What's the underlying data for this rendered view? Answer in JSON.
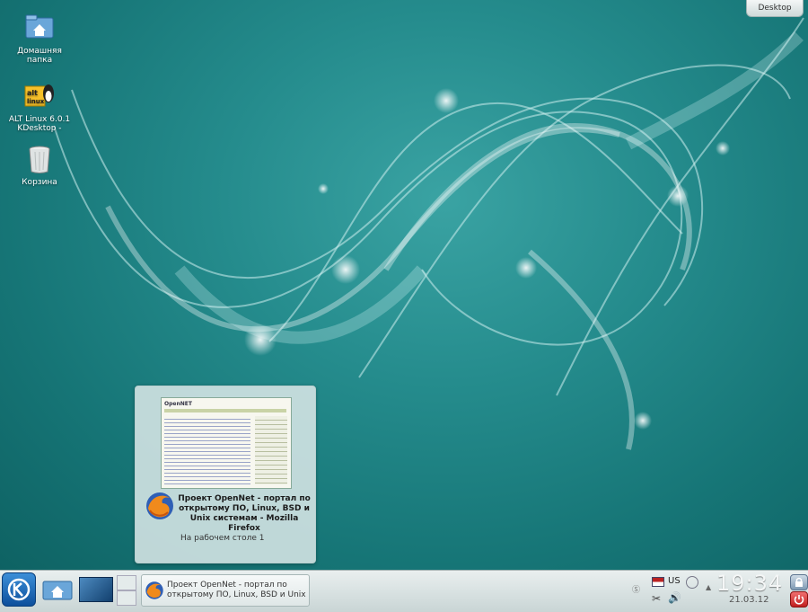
{
  "desktop": {
    "icons": [
      {
        "label_line1": "Домашняя",
        "label_line2": "папка",
        "icon": "home-folder-icon"
      },
      {
        "label_line1": "ALT Linux 6.0.1",
        "label_line2": "KDesktop - ",
        "icon": "alt-linux-icon"
      },
      {
        "label_line1": "Корзина",
        "label_line2": "",
        "icon": "trash-icon"
      }
    ],
    "toolbox_label": "Desktop"
  },
  "tooltip": {
    "title": "Проект OpenNet - портал по открытому ПО, Linux, BSD и Unix системам - Mozilla Firefox",
    "subtitle": "На рабочем столе 1",
    "thumbnail_logo": "OpenNET"
  },
  "panel": {
    "task_title": "Проект OpenNet - портал по открытому ПО, Linux, BSD и Unix",
    "keyboard_layout": "US",
    "time": "19:34",
    "date": "21.03.12"
  },
  "colors": {
    "wallpaper": "#1f7f80",
    "panel": "#dbe4e4",
    "kde_blue": "#1a63b6"
  }
}
